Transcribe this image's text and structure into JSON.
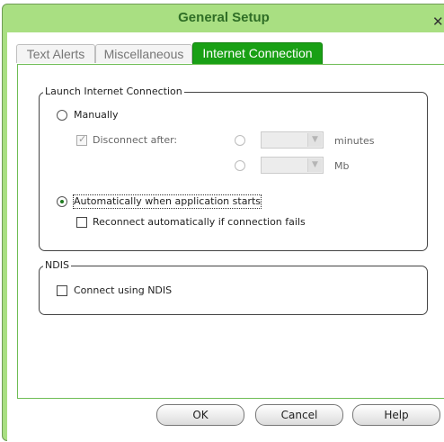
{
  "window": {
    "title": "General Setup",
    "close_glyph": "✕"
  },
  "tabs": [
    {
      "label": "Text Alerts",
      "active": false
    },
    {
      "label": "Miscellaneous",
      "active": false
    },
    {
      "label": "Internet Connection",
      "active": true
    }
  ],
  "launch_group": {
    "legend": "Launch Internet Connection",
    "manually_label": "Manually",
    "disconnect_label": "Disconnect after:",
    "minutes_unit": "minutes",
    "mb_unit": "Mb",
    "auto_label": "Automatically when application starts",
    "reconnect_label": "Reconnect automatically if connection fails"
  },
  "ndis_group": {
    "legend": "NDIS",
    "connect_label": "Connect using NDIS"
  },
  "buttons": {
    "ok": "OK",
    "cancel": "Cancel",
    "help": "Help"
  },
  "colors": {
    "frame": "#a9df82",
    "active_tab": "#19a015",
    "title_text": "#2f6e26"
  },
  "icons": {
    "dropdown": "chevron-down-icon",
    "close": "close-icon"
  }
}
